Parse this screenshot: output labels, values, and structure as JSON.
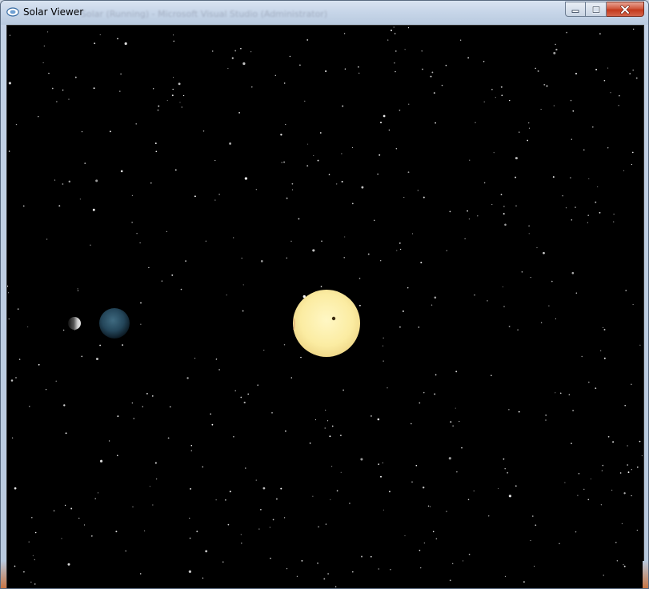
{
  "window": {
    "title": "Solar Viewer",
    "background_title": "Solar (Running) - Microsoft Visual Studio (Administrator)",
    "controls": {
      "minimize_icon": "minimize-icon",
      "maximize_icon": "maximize-icon",
      "close_icon": "close-icon"
    }
  },
  "scene": {
    "background_color": "#000000",
    "bodies": [
      {
        "name": "sun",
        "color": "#fbeea6"
      },
      {
        "name": "planet",
        "color": "#2d4d5e"
      },
      {
        "name": "moon",
        "color": "#b8b8b8"
      }
    ]
  }
}
